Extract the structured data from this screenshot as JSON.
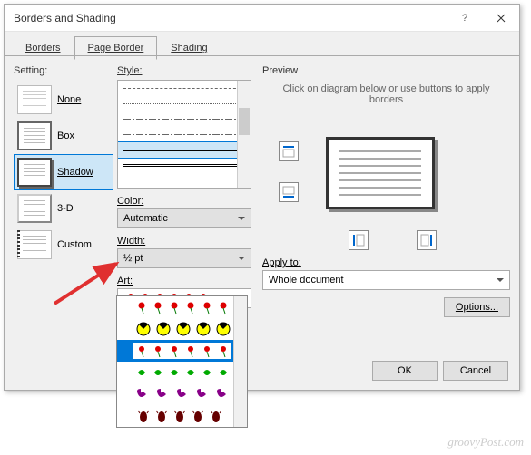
{
  "title": "Borders and Shading",
  "tabs": [
    "Borders",
    "Page Border",
    "Shading"
  ],
  "active_tab": 1,
  "setting": {
    "label": "Setting:",
    "options": [
      "None",
      "Box",
      "Shadow",
      "3-D",
      "Custom"
    ],
    "selected": 2
  },
  "style": {
    "label": "Style:"
  },
  "color": {
    "label": "Color:",
    "value": "Automatic"
  },
  "width": {
    "label": "Width:",
    "value": "½ pt"
  },
  "art": {
    "label": "Art:",
    "options": [
      "flowers-red",
      "radiation",
      "flowers-blue-band",
      "green-shapes",
      "butterflies",
      "beetles"
    ],
    "selected": 2
  },
  "preview": {
    "label": "Preview",
    "hint": "Click on diagram below or use buttons to apply borders"
  },
  "apply": {
    "label": "Apply to:",
    "value": "Whole document"
  },
  "buttons": {
    "options": "Options...",
    "ok": "OK",
    "cancel": "Cancel"
  },
  "watermark": "groovyPost.com"
}
